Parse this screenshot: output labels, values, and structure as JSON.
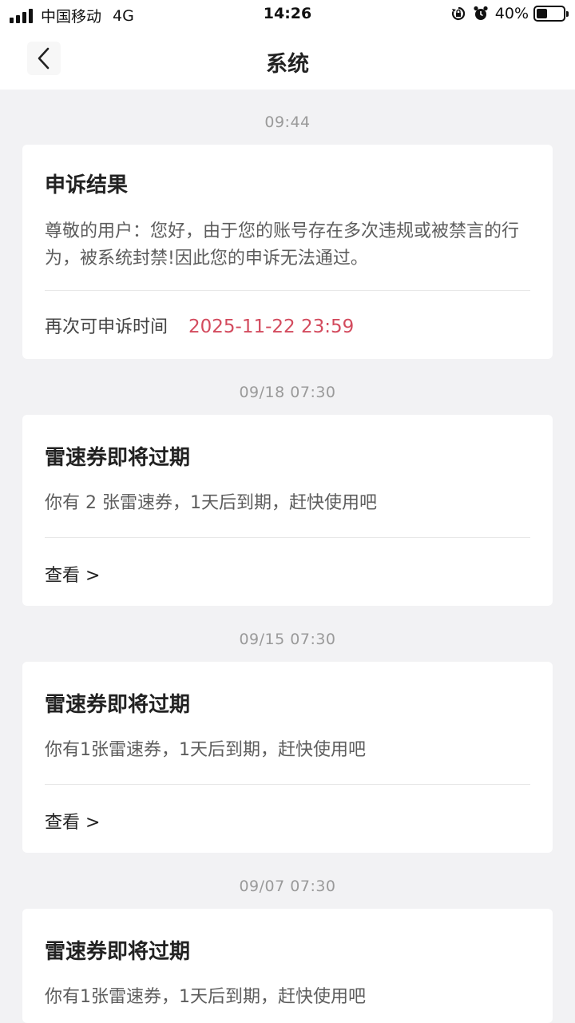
{
  "status_bar": {
    "carrier": "中国移动",
    "network": "4G",
    "time": "14:26",
    "battery": "40%",
    "battery_level": 0.4,
    "icons": [
      "signal-icon",
      "orientation-lock-icon",
      "alarm-icon",
      "battery-icon"
    ]
  },
  "nav": {
    "title": "系统",
    "back_icon": "chevron-left-icon"
  },
  "messages": [
    {
      "time": "09:44",
      "title": "申诉结果",
      "body": "尊敬的用户：您好，由于您的账号存在多次违规或被禁言的行为，被系统封禁!因此您的申诉无法通过。",
      "footer_label": "再次可申诉时间",
      "footer_value": "2025-11-22 23:59"
    },
    {
      "time": "09/18 07:30",
      "title": "雷速券即将过期",
      "body": "你有 2 张雷速券，1天后到期，赶快使用吧",
      "link": "查看 >"
    },
    {
      "time": "09/15 07:30",
      "title": "雷速券即将过期",
      "body": "你有1张雷速券，1天后到期，赶快使用吧",
      "link": "查看 >"
    },
    {
      "time": "09/07 07:30",
      "title": "雷速券即将过期",
      "body": "你有1张雷速券，1天后到期，赶快使用吧"
    }
  ],
  "colors": {
    "background": "#f2f2f4",
    "card": "#ffffff",
    "accent_red": "#d34b5e",
    "muted": "#9a9a9a"
  }
}
